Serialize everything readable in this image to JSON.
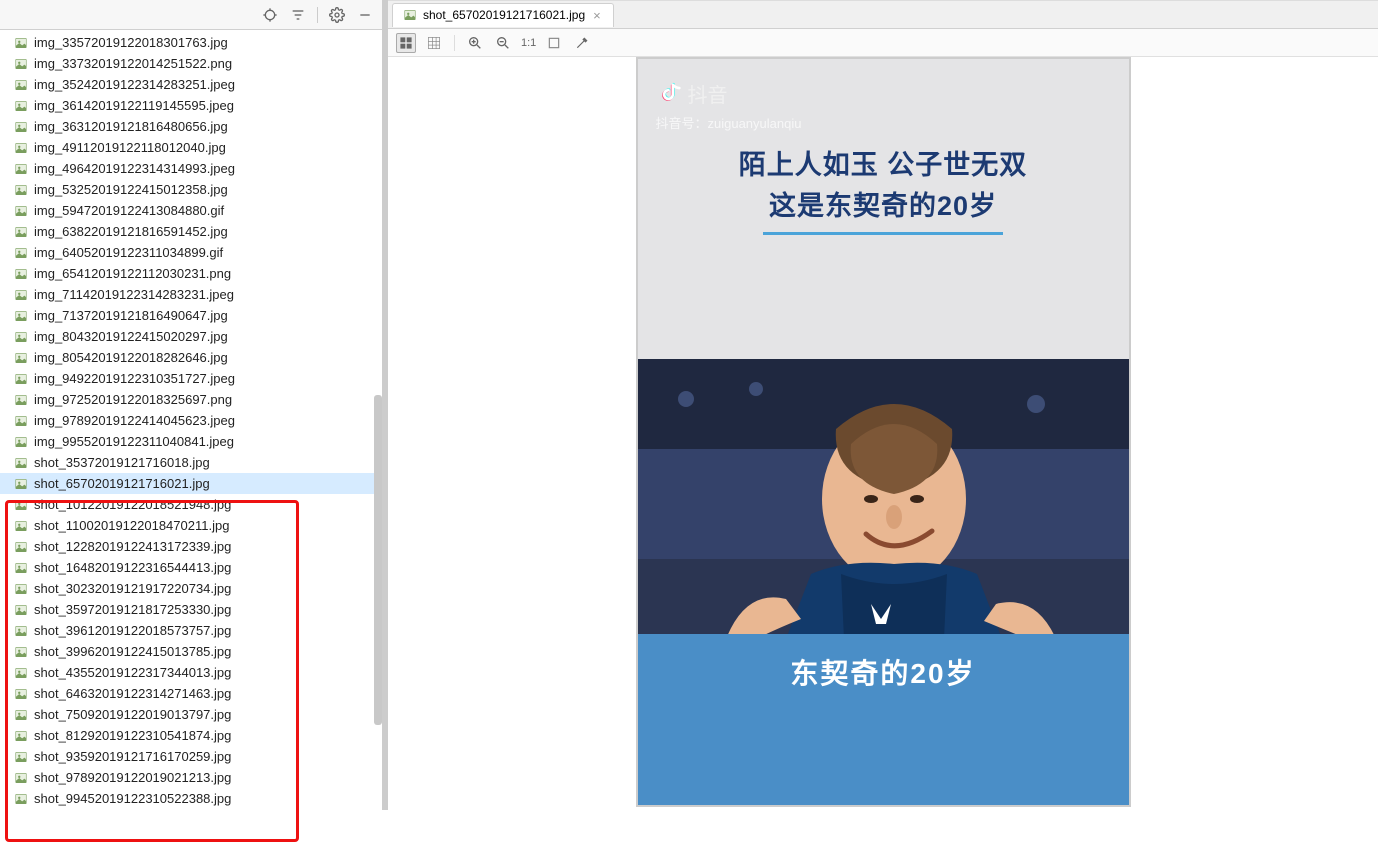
{
  "sidebar": {
    "files": [
      "img_33572019122018301763.jpg",
      "img_33732019122014251522.png",
      "img_35242019122314283251.jpeg",
      "img_36142019122119145595.jpeg",
      "img_36312019121816480656.jpg",
      "img_49112019122118012040.jpg",
      "img_49642019122314314993.jpeg",
      "img_53252019122415012358.jpg",
      "img_59472019122413084880.gif",
      "img_63822019121816591452.jpg",
      "img_64052019122311034899.gif",
      "img_65412019122112030231.png",
      "img_71142019122314283231.jpeg",
      "img_71372019121816490647.jpg",
      "img_80432019122415020297.jpg",
      "img_80542019122018282646.jpg",
      "img_94922019122310351727.jpeg",
      "img_97252019122018325697.png",
      "img_97892019122414045623.jpeg",
      "img_99552019122311040841.jpeg",
      "shot_35372019121716018.jpg",
      "shot_65702019121716021.jpg",
      "shot_10122019122018521948.jpg",
      "shot_11002019122018470211.jpg",
      "shot_12282019122413172339.jpg",
      "shot_16482019122316544413.jpg",
      "shot_30232019121917220734.jpg",
      "shot_35972019121817253330.jpg",
      "shot_39612019122018573757.jpg",
      "shot_39962019122415013785.jpg",
      "shot_43552019122317344013.jpg",
      "shot_64632019122314271463.jpg",
      "shot_75092019122019013797.jpg",
      "shot_81292019122310541874.jpg",
      "shot_93592019121716170259.jpg",
      "shot_97892019122019021213.jpg",
      "shot_99452019122310522388.jpg"
    ],
    "selectedIndex": 21,
    "highlightStartIndex": 21,
    "highlightEndIndex": 36
  },
  "tab": {
    "title": "shot_65702019121716021.jpg"
  },
  "viewerToolbar": {
    "oneToOne": "1:1"
  },
  "image": {
    "logoText": "抖音",
    "accountId": "抖音号：zuiguanyulanqiu",
    "titleLine1": "陌上人如玉 公子世无双",
    "titleLine2": "这是东契奇的20岁",
    "caption": "东契奇的20岁"
  }
}
